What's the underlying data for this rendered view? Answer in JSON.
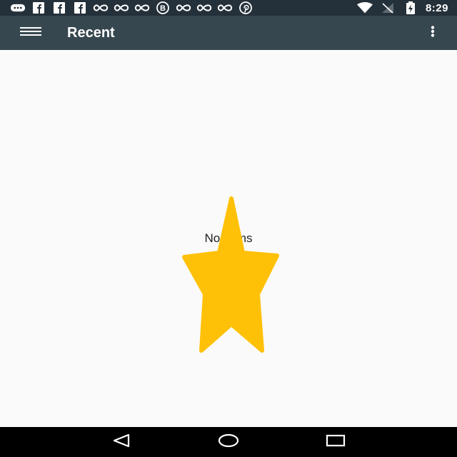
{
  "status_bar": {
    "time": "8:29",
    "left_icons": [
      "more-horizontal-icon",
      "facebook-icon",
      "facebook-icon",
      "facebook-icon",
      "infinity-icon",
      "infinity-icon",
      "infinity-icon",
      "b-circle-icon",
      "infinity-icon",
      "infinity-icon",
      "infinity-icon",
      "pinterest-icon"
    ],
    "right_icons": [
      "wifi-icon",
      "signal-icon",
      "battery-charging-icon"
    ]
  },
  "app_bar": {
    "title": "Recent",
    "left_icon": "hamburger-menu-icon",
    "right_icon": "overflow-menu-icon"
  },
  "main": {
    "empty_message": "No items"
  },
  "nav_bar": {
    "buttons": [
      "back-icon",
      "home-icon",
      "recents-icon"
    ]
  },
  "colors": {
    "status_bar": "#25313a",
    "app_bar": "#37474f",
    "background": "#fafafa",
    "star": "#ffc107",
    "nav_bar": "#000000"
  }
}
